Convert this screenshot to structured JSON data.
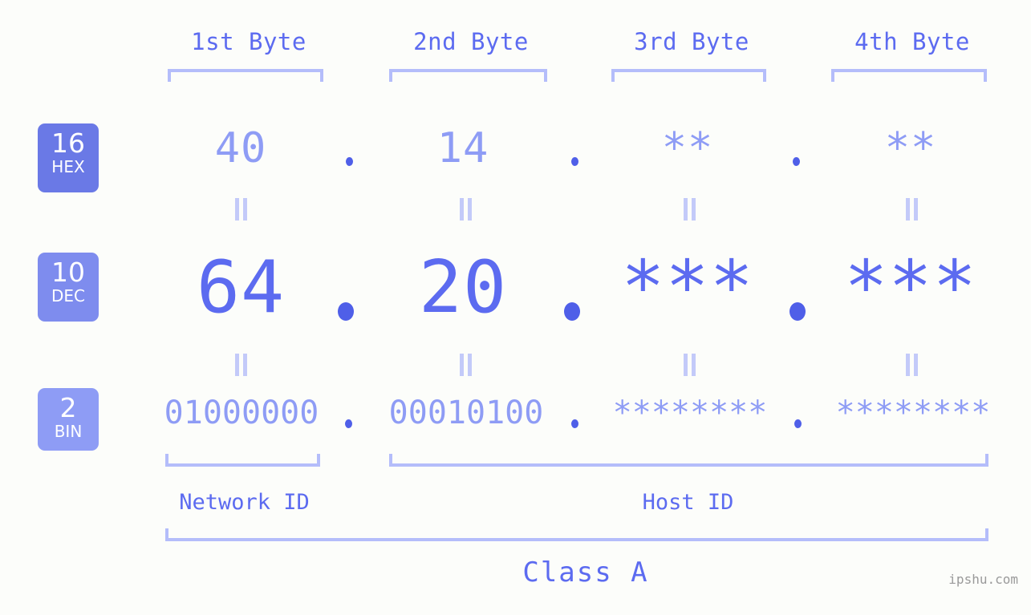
{
  "background_color": "#fcfdfa",
  "accent_strong": "#5c6bf0",
  "accent_light": "#8e9cf5",
  "accent_bracket": "#b4bdfa",
  "byte_headers": [
    {
      "label": "1st Byte"
    },
    {
      "label": "2nd Byte"
    },
    {
      "label": "3rd Byte"
    },
    {
      "label": "4th Byte"
    }
  ],
  "rows": [
    {
      "badge_number": "16",
      "badge_system": "HEX",
      "badge_color": "#6a79e6",
      "values": [
        "40",
        "14",
        "**",
        "**"
      ]
    },
    {
      "badge_number": "10",
      "badge_system": "DEC",
      "badge_color": "#7e8cee",
      "values": [
        "64",
        "20",
        "***",
        "***"
      ]
    },
    {
      "badge_number": "2",
      "badge_system": "BIN",
      "badge_color": "#8e9cf5",
      "values": [
        "01000000",
        "00010100",
        "********",
        "********"
      ]
    }
  ],
  "separator_dot": ".",
  "equals_mark": "=",
  "id_labels": [
    {
      "label": "Network ID"
    },
    {
      "label": "Host ID"
    }
  ],
  "class_label": "Class A",
  "watermark": "ipshu.com"
}
